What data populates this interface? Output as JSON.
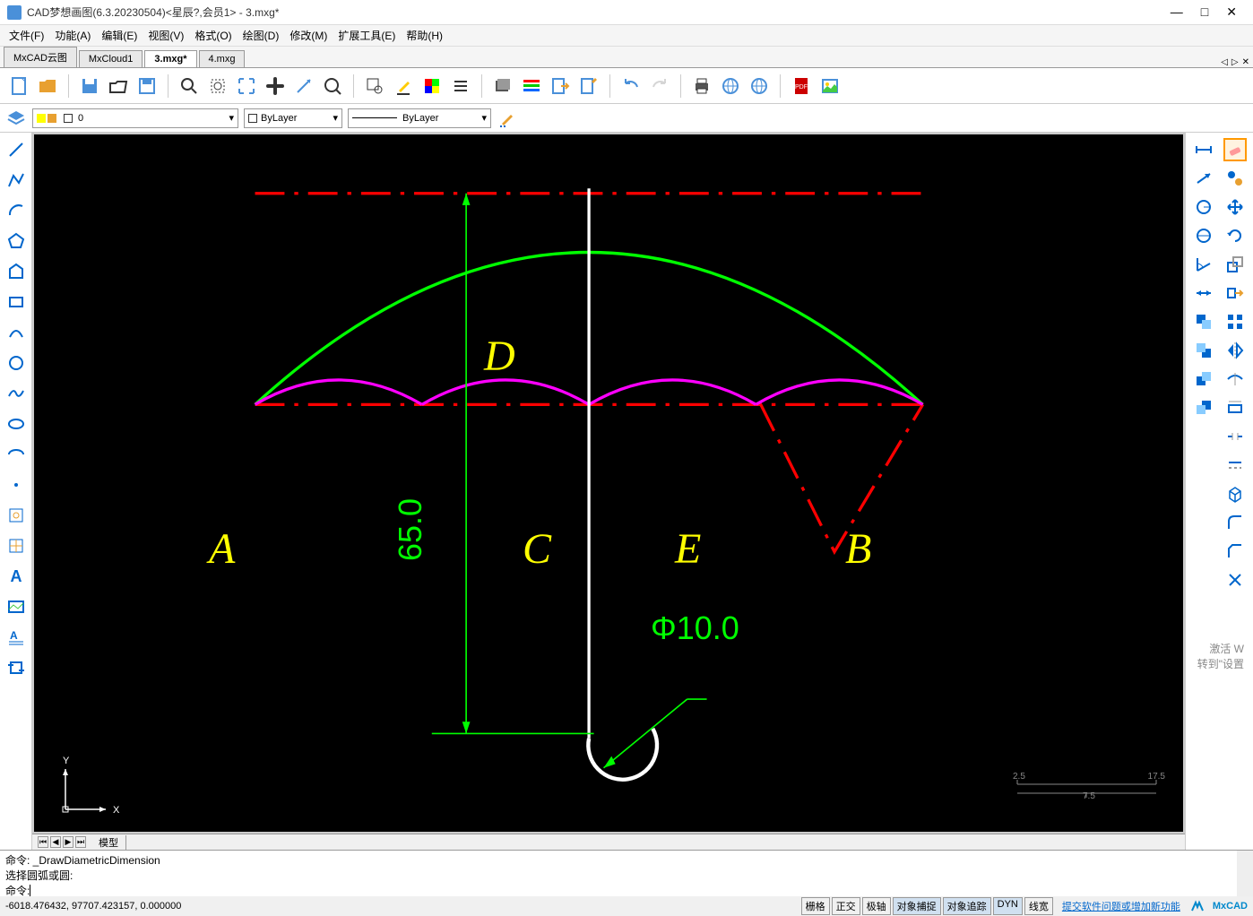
{
  "title": "CAD梦想画图(6.3.20230504)<星辰?,会员1> - 3.mxg*",
  "menus": [
    "文件(F)",
    "功能(A)",
    "编辑(E)",
    "视图(V)",
    "格式(O)",
    "绘图(D)",
    "修改(M)",
    "扩展工具(E)",
    "帮助(H)"
  ],
  "tabs": [
    "MxCAD云图",
    "MxCloud1",
    "3.mxg*",
    "4.mxg"
  ],
  "active_tab": 2,
  "layer_combo": "0",
  "bylayer_combo": "ByLayer",
  "linetype_combo": "ByLayer",
  "model_tab": "模型",
  "command_history": [
    "命令:  _DrawDiametricDimension",
    "选择圆弧或圆:"
  ],
  "command_prompt": "命令:",
  "status_coords": "-6018.476432,  97707.423157,  0.000000",
  "status_buttons": [
    "栅格",
    "正交",
    "极轴",
    "对象捕捉",
    "对象追踪",
    "DYN",
    "线宽"
  ],
  "status_active": [
    3,
    4,
    5
  ],
  "status_link": "提交软件问题或增加新功能",
  "status_brand": "MxCAD",
  "watermark1": "激活 W",
  "watermark2": "转到\"设置",
  "ruler_vals": [
    "2.5",
    "17.5",
    "7.5"
  ],
  "drawing": {
    "labels": [
      "A",
      "B",
      "C",
      "D",
      "E"
    ],
    "dim_65": "65.0",
    "dim_dia": "Φ10.0"
  }
}
